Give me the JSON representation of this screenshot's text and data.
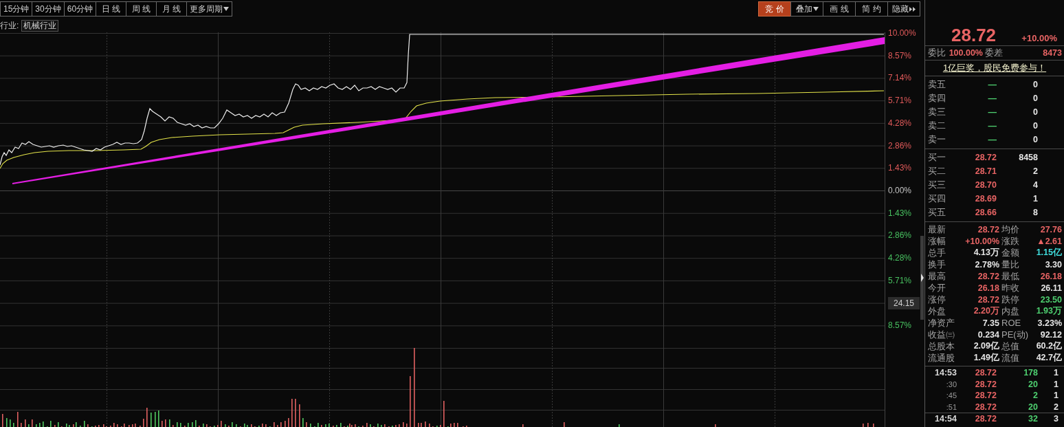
{
  "toolbar_left": [
    {
      "label": "15分钟",
      "selected": false,
      "kind": "plain"
    },
    {
      "label": "30分钟",
      "selected": false,
      "kind": "plain"
    },
    {
      "label": "60分钟",
      "selected": false,
      "kind": "plain"
    },
    {
      "label": "日 线",
      "selected": false,
      "kind": "plain"
    },
    {
      "label": "周 线",
      "selected": false,
      "kind": "plain"
    },
    {
      "label": "月 线",
      "selected": false,
      "kind": "plain"
    },
    {
      "label": "更多周期",
      "selected": false,
      "kind": "menu"
    }
  ],
  "toolbar_right": [
    {
      "label": "竞 价",
      "selected": true,
      "kind": "plain"
    },
    {
      "label": "叠加",
      "selected": false,
      "kind": "menu"
    },
    {
      "label": "画 线",
      "selected": false,
      "kind": "plain"
    },
    {
      "label": "简 约",
      "selected": false,
      "kind": "plain"
    },
    {
      "label": "隐藏",
      "selected": false,
      "kind": "expand"
    }
  ],
  "industry": {
    "label": "行业:",
    "value": "机械行业"
  },
  "price_axis": [
    {
      "text": "10.00%",
      "kind": "up"
    },
    {
      "text": "8.57%",
      "kind": "up"
    },
    {
      "text": "7.14%",
      "kind": "up"
    },
    {
      "text": "5.71%",
      "kind": "up"
    },
    {
      "text": "4.28%",
      "kind": "up"
    },
    {
      "text": "2.86%",
      "kind": "up"
    },
    {
      "text": "1.43%",
      "kind": "up"
    },
    {
      "text": "0.00%",
      "kind": "flat"
    },
    {
      "text": "1.43%",
      "kind": "down"
    },
    {
      "text": "2.86%",
      "kind": "down"
    },
    {
      "text": "4.28%",
      "kind": "down"
    },
    {
      "text": "5.71%",
      "kind": "down"
    },
    {
      "text": "24.15",
      "kind": "cursor"
    },
    {
      "text": "8.57%",
      "kind": "down"
    }
  ],
  "quote": {
    "price": "28.72",
    "change": "+10.00%"
  },
  "order_ratio": {
    "label": "委比",
    "value": "100.00%",
    "diff_label": "委差",
    "diff_value": "8473"
  },
  "promo_link": "1亿巨奖，股民免费参与！",
  "sell_orders": [
    {
      "label": "卖五",
      "price": "—",
      "volume": "0"
    },
    {
      "label": "卖四",
      "price": "—",
      "volume": "0"
    },
    {
      "label": "卖三",
      "price": "—",
      "volume": "0"
    },
    {
      "label": "卖二",
      "price": "—",
      "volume": "0"
    },
    {
      "label": "卖一",
      "price": "—",
      "volume": "0"
    }
  ],
  "buy_orders": [
    {
      "label": "买一",
      "price": "28.72",
      "volume": "8458"
    },
    {
      "label": "买二",
      "price": "28.71",
      "volume": "2"
    },
    {
      "label": "买三",
      "price": "28.70",
      "volume": "4"
    },
    {
      "label": "买四",
      "price": "28.69",
      "volume": "1"
    },
    {
      "label": "买五",
      "price": "28.66",
      "volume": "8"
    }
  ],
  "stats": [
    {
      "label": "最新",
      "value": "28.72",
      "color": "#e86464"
    },
    {
      "label": "均价",
      "value": "27.76",
      "color": "#e86464"
    },
    {
      "label": "涨幅",
      "value": "+10.00%",
      "color": "#e86464"
    },
    {
      "label": "涨跌",
      "value": "▲2.61",
      "color": "#e86464"
    },
    {
      "label": "总手",
      "value": "4.13万",
      "color": "#e6e6e6"
    },
    {
      "label": "金额",
      "value": "1.15亿",
      "color": "#40dede"
    },
    {
      "label": "换手",
      "value": "2.78%",
      "color": "#e6e6e6"
    },
    {
      "label": "量比",
      "value": "3.30",
      "color": "#e6e6e6"
    },
    {
      "label": "最高",
      "value": "28.72",
      "color": "#e86464"
    },
    {
      "label": "最低",
      "value": "26.18",
      "color": "#e86464"
    },
    {
      "label": "今开",
      "value": "26.18",
      "color": "#e86464"
    },
    {
      "label": "昨收",
      "value": "26.11",
      "color": "#e6e6e6"
    },
    {
      "label": "涨停",
      "value": "28.72",
      "color": "#e86464"
    },
    {
      "label": "跌停",
      "value": "23.50",
      "color": "#4ed070"
    },
    {
      "label": "外盘",
      "value": "2.20万",
      "color": "#e86464"
    },
    {
      "label": "内盘",
      "value": "1.93万",
      "color": "#4ed070"
    },
    {
      "label": "净资产",
      "value": "7.35",
      "color": "#e6e6e6"
    },
    {
      "label": "ROE",
      "value": "3.23%",
      "color": "#e6e6e6"
    },
    {
      "label": "收益㈢",
      "value": "0.234",
      "color": "#e6e6e6"
    },
    {
      "label": "PE(动)",
      "value": "92.12",
      "color": "#e6e6e6"
    },
    {
      "label": "总股本",
      "value": "2.09亿",
      "color": "#e6e6e6"
    },
    {
      "label": "总值",
      "value": "60.2亿",
      "color": "#e6e6e6"
    },
    {
      "label": "流通股",
      "value": "1.49亿",
      "color": "#e6e6e6"
    },
    {
      "label": "流值",
      "value": "42.7亿",
      "color": "#e6e6e6"
    }
  ],
  "ticks": [
    {
      "time": "14:53",
      "price": "28.72",
      "volume": "178",
      "count": "1",
      "kind": "minute"
    },
    {
      "time": ":30",
      "price": "28.72",
      "volume": "20",
      "count": "1",
      "kind": "second"
    },
    {
      "time": ":45",
      "price": "28.72",
      "volume": "2",
      "count": "1",
      "kind": "second"
    },
    {
      "time": ":51",
      "price": "28.72",
      "volume": "20",
      "count": "2",
      "kind": "second"
    },
    {
      "time": "14:54",
      "price": "28.72",
      "volume": "32",
      "count": "3",
      "kind": "minute"
    }
  ]
}
